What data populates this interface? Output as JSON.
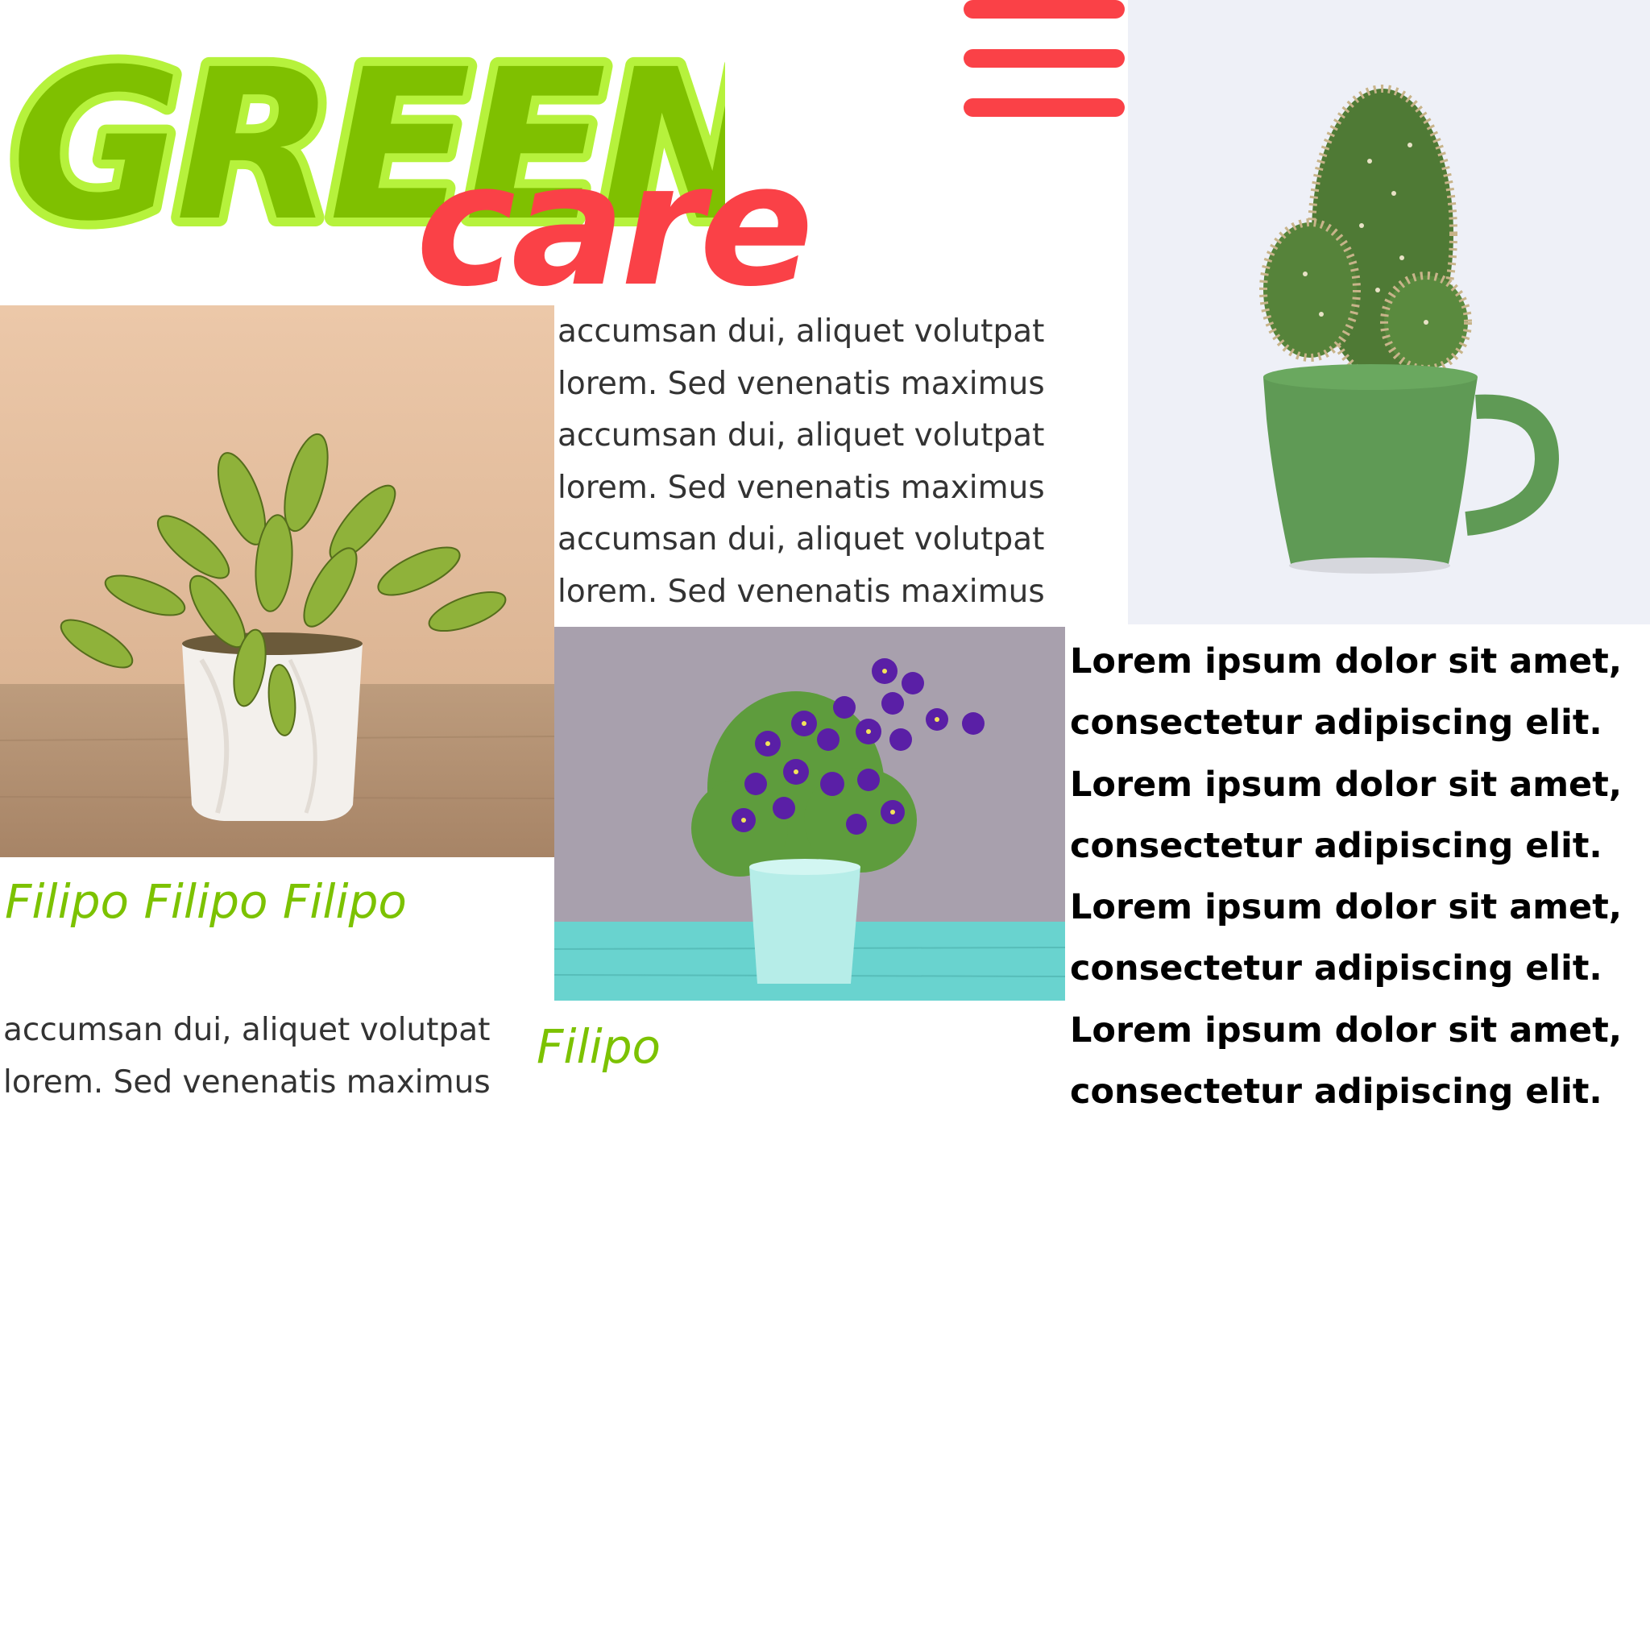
{
  "logo": {
    "green_word": "GREEN",
    "care_word": "care",
    "green_fill": "#7fc000",
    "green_outline": "#b6f23c",
    "care_color": "#fa4147"
  },
  "menu": {
    "icon": "hamburger-menu-icon",
    "color": "#fa4147"
  },
  "images": {
    "pothos": "potted-pothos-plant-photo",
    "cactus": "cactus-in-green-mug-photo",
    "pansy": "purple-pansy-flower-pot-photo"
  },
  "text_mid": "accumsan dui, aliquet volutpat\nlorem. Sed venenatis maximus\naccumsan dui, aliquet volutpat\nlorem. Sed venenatis maximus\naccumsan dui, aliquet volutpat\nlorem. Sed venenatis maximus",
  "text_bold": "Lorem ipsum dolor sit amet,\nconsectetur adipiscing elit.\nLorem ipsum dolor sit amet,\nconsectetur adipiscing elit.\nLorem ipsum dolor sit amet,\nconsectetur adipiscing elit.\nLorem ipsum dolor sit amet,\nconsectetur adipiscing elit.",
  "caption_left": "Filipo Filipo Filipo",
  "text_left": "accumsan dui, aliquet volutpat\nlorem. Sed venenatis maximus",
  "caption_mid": "Filipo",
  "colors": {
    "caption_green": "#7cc200",
    "body_text": "#333333",
    "bold_text": "#000000"
  }
}
